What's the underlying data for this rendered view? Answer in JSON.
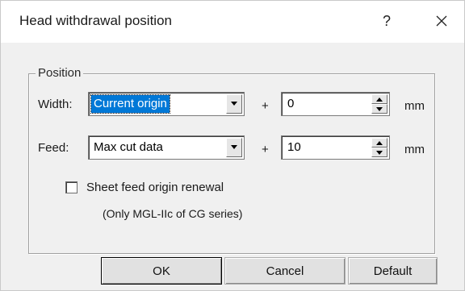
{
  "dialog": {
    "title": "Head withdrawal position",
    "help_label": "?",
    "close_icon": "close-icon"
  },
  "position_group": {
    "label": "Position",
    "width": {
      "label": "Width:",
      "selected": "Current origin",
      "plus": "+",
      "value": "0",
      "unit": "mm"
    },
    "feed": {
      "label": "Feed:",
      "selected": "Max cut data",
      "plus": "+",
      "value": "10",
      "unit": "mm"
    },
    "sheet_feed": {
      "label": "Sheet feed origin renewal",
      "checked": false,
      "note": "(Only MGL-IIc of CG series)"
    }
  },
  "buttons": {
    "ok": "OK",
    "cancel": "Cancel",
    "default": "Default"
  },
  "colors": {
    "selection": "#0078d7",
    "dialog_bg": "#f0f0f0"
  }
}
